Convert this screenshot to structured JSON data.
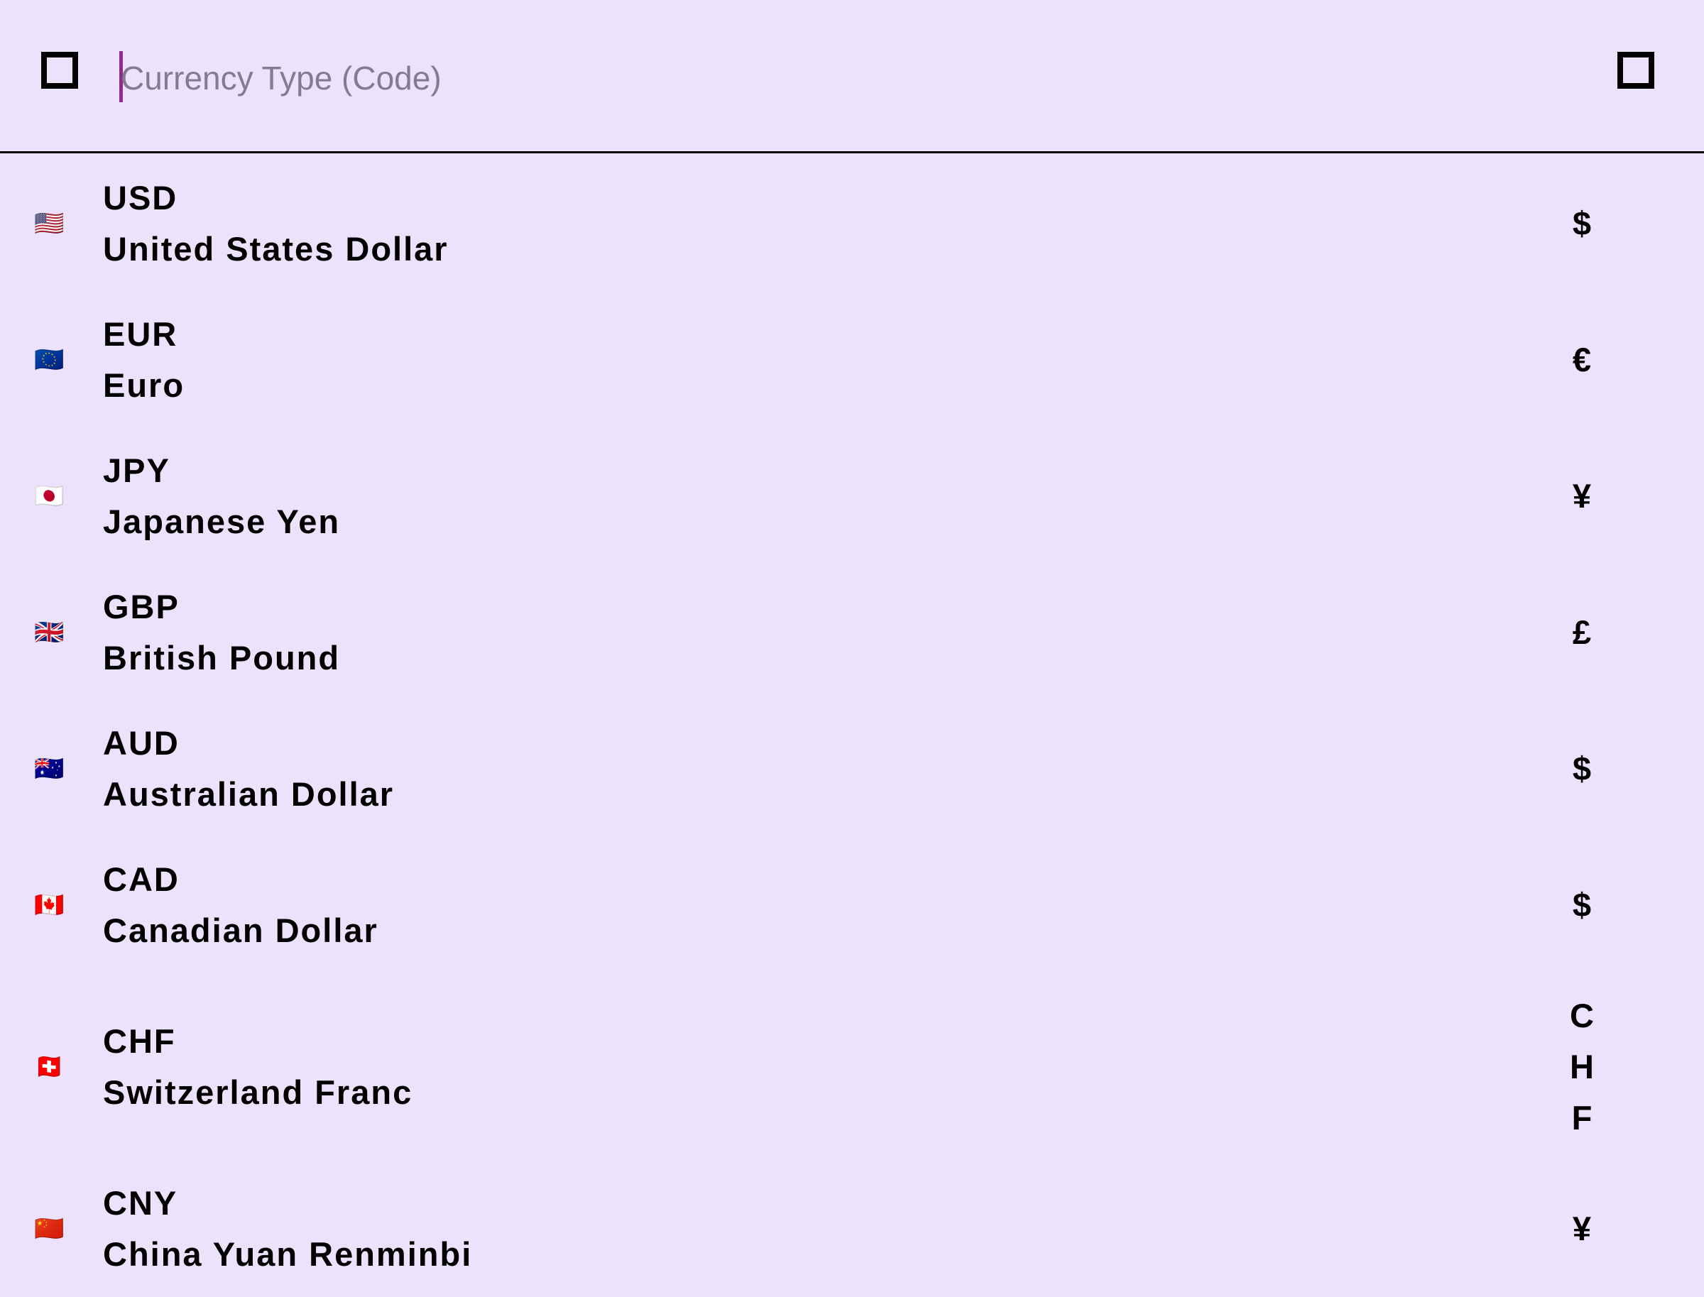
{
  "search": {
    "placeholder": "Currency Type (Code)",
    "value": ""
  },
  "currencies": [
    {
      "flag": "🇺🇸",
      "code": "USD",
      "name": "United States Dollar",
      "symbol": "$"
    },
    {
      "flag": "🇪🇺",
      "code": "EUR",
      "name": "Euro",
      "symbol": "€"
    },
    {
      "flag": "🇯🇵",
      "code": "JPY",
      "name": "Japanese Yen",
      "symbol": "¥"
    },
    {
      "flag": "🇬🇧",
      "code": "GBP",
      "name": "British Pound",
      "symbol": "£"
    },
    {
      "flag": "🇦🇺",
      "code": "AUD",
      "name": "Australian Dollar",
      "symbol": "$"
    },
    {
      "flag": "🇨🇦",
      "code": "CAD",
      "name": "Canadian Dollar",
      "symbol": "$"
    },
    {
      "flag": "🇨🇭",
      "code": "CHF",
      "name": "Switzerland Franc",
      "symbol": "CHF"
    },
    {
      "flag": "🇨🇳",
      "code": "CNY",
      "name": "China Yuan Renminbi",
      "symbol": "¥"
    }
  ]
}
